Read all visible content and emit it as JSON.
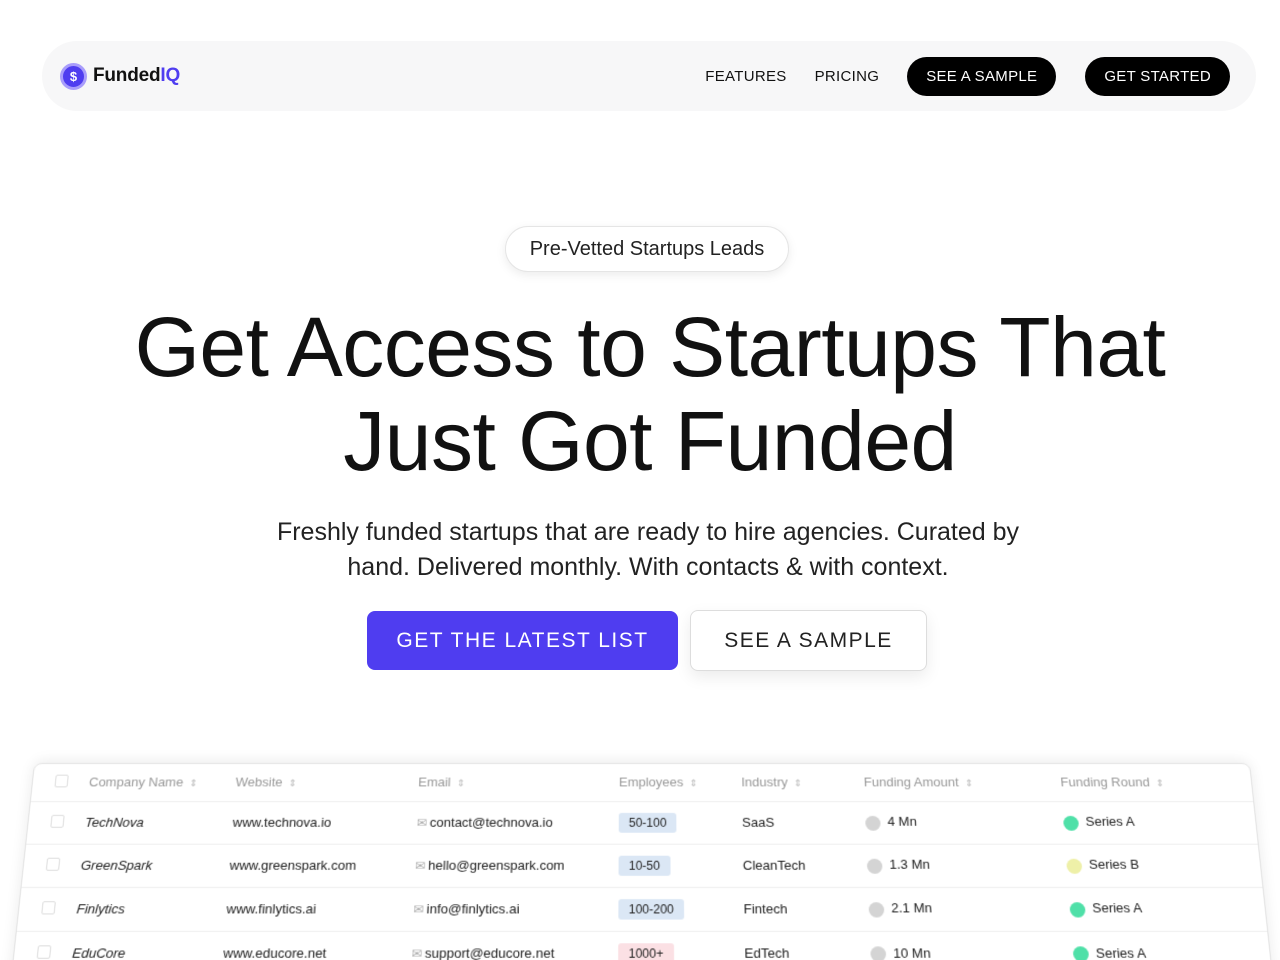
{
  "brand": {
    "name_part1": "Funded",
    "name_part2": "IQ",
    "icon": "dollar-coin-icon",
    "accent": "#4f3df0"
  },
  "nav": {
    "features": "FEATURES",
    "pricing": "PRICING",
    "see_sample": "SEE A SAMPLE",
    "get_started": "GET STARTED"
  },
  "hero": {
    "badge": "Pre-Vetted Startups Leads",
    "headline_line1": "Get Access to Startups That",
    "headline_line2": "Just Got Funded",
    "subhead_line1": "Freshly funded startups that are ready to hire agencies. Curated by",
    "subhead_line2": "hand. Delivered monthly. With contacts & with context.",
    "cta_primary": "GET THE LATEST LIST",
    "cta_secondary": "SEE A SAMPLE"
  },
  "table": {
    "headers": [
      "Company Name",
      "Website",
      "Email",
      "Employees",
      "Industry",
      "Funding Amount",
      "Funding Round"
    ],
    "rows": [
      {
        "company": "TechNova",
        "website": "www.technova.io",
        "email": "contact@technova.io",
        "employees": "50-100",
        "employees_color": "#dbe7f5",
        "industry": "SaaS",
        "amount": "4 Mn",
        "round": "Series A",
        "round_color": "#4fe0a8"
      },
      {
        "company": "GreenSpark",
        "website": "www.greenspark.com",
        "email": "hello@greenspark.com",
        "employees": "10-50",
        "employees_color": "#dbe7f5",
        "industry": "CleanTech",
        "amount": "1.3 Mn",
        "round": "Series B",
        "round_color": "#eef0a8"
      },
      {
        "company": "Finlytics",
        "website": "www.finlytics.ai",
        "email": "info@finlytics.ai",
        "employees": "100-200",
        "employees_color": "#dbe7f5",
        "industry": "Fintech",
        "amount": "2.1 Mn",
        "round": "Series A",
        "round_color": "#4fe0a8"
      },
      {
        "company": "EduCore",
        "website": "www.educore.net",
        "email": "support@educore.net",
        "employees": "1000+",
        "employees_color": "#fbe0e4",
        "industry": "EdTech",
        "amount": "10 Mn",
        "round": "Series A",
        "round_color": "#4fe0a8"
      }
    ]
  }
}
